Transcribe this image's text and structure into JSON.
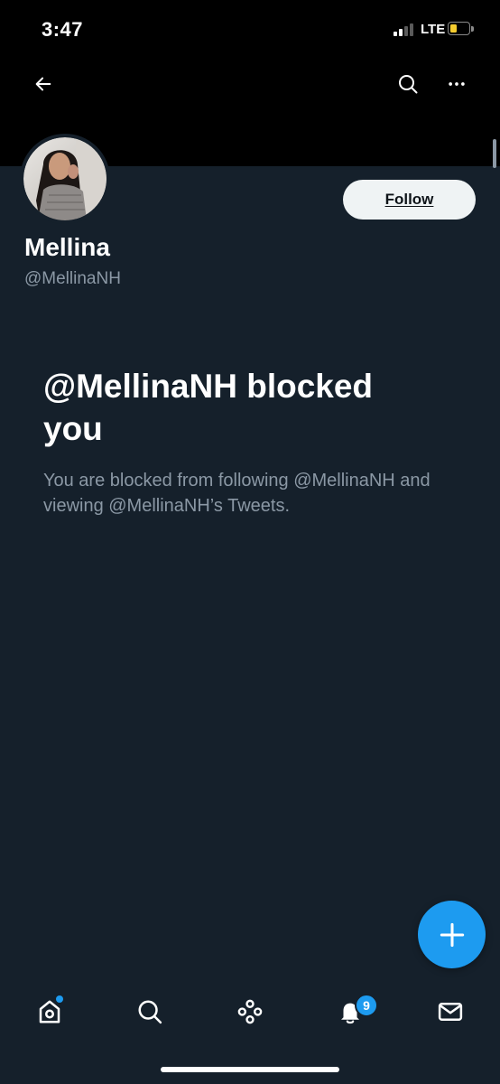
{
  "status_bar": {
    "time": "3:47",
    "network": "LTE",
    "signal_bars": 2,
    "battery_level": 0.25,
    "battery_color": "#f5cc2e"
  },
  "header": {
    "back_icon": "arrow-left-icon",
    "search_icon": "search-icon",
    "more_icon": "more-horizontal-icon"
  },
  "profile": {
    "display_name": "Mellina",
    "handle": "@MellinaNH",
    "follow_label": "Follow"
  },
  "blocked": {
    "title": "@MellinaNH blocked you",
    "description": "You are blocked from following @MellinaNH and viewing @MellinaNH’s Tweets."
  },
  "fab": {
    "icon": "plus-icon"
  },
  "bottom_nav": {
    "items": [
      {
        "name": "home",
        "icon": "home-icon",
        "has_dot": true
      },
      {
        "name": "search",
        "icon": "search-icon"
      },
      {
        "name": "spaces",
        "icon": "spaces-icon"
      },
      {
        "name": "notifications",
        "icon": "bell-icon",
        "badge": "9"
      },
      {
        "name": "messages",
        "icon": "mail-icon"
      }
    ]
  },
  "colors": {
    "background": "#15202b",
    "banner": "#000000",
    "accent": "#1d9bf0",
    "secondary_text": "#8b98a5",
    "follow_button_bg": "#eff3f4"
  }
}
